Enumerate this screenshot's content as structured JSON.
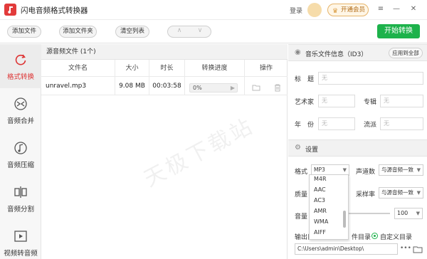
{
  "titlebar": {
    "app_title": "闪电音频格式转换器",
    "login": "登录",
    "vip_label": "开通会员"
  },
  "toolbar": {
    "add_file": "添加文件",
    "add_folder": "添加文件夹",
    "clear_list": "清空列表",
    "start": "开始转换"
  },
  "sidebar": {
    "items": [
      {
        "label": "格式转换",
        "icon": "refresh-icon"
      },
      {
        "label": "音频合并",
        "icon": "merge-icon"
      },
      {
        "label": "音频压缩",
        "icon": "note-icon"
      },
      {
        "label": "音频分割",
        "icon": "split-icon"
      },
      {
        "label": "视频转音频",
        "icon": "video-icon"
      }
    ]
  },
  "filelist": {
    "header": "源音频文件 (1个)",
    "columns": [
      "文件名",
      "大小",
      "时长",
      "转换进度",
      "操作"
    ],
    "rows": [
      {
        "name": "unravel.mp3",
        "size": "9.08 MB",
        "duration": "00:03:58",
        "progress": "0%"
      }
    ]
  },
  "watermark": "天极下载站",
  "info": {
    "title": "音乐文件信息（ID3）",
    "apply_all": "应用到全部",
    "field_title": "标　题",
    "field_artist": "艺术家",
    "field_album": "专辑",
    "field_year": "年　份",
    "field_genre": "流派",
    "placeholder": "无"
  },
  "settings": {
    "title": "设置",
    "format_label": "格式",
    "format_value": "MP3",
    "channel_label": "声道数",
    "channel_value": "与源音频一致",
    "quality_label": "质量",
    "sample_label": "采样率",
    "sample_value": "与源音频一致",
    "volume_label": "音量",
    "volume_value": "100",
    "output_label": "输出目",
    "src_dir_label": "件目录",
    "custom_dir_label": "自定义目录",
    "output_path": "C:\\Users\\admin\\Desktop\\",
    "more": "•••",
    "format_options": [
      "M4R",
      "AAC",
      "AC3",
      "AMR",
      "WMA",
      "AIFF"
    ]
  }
}
